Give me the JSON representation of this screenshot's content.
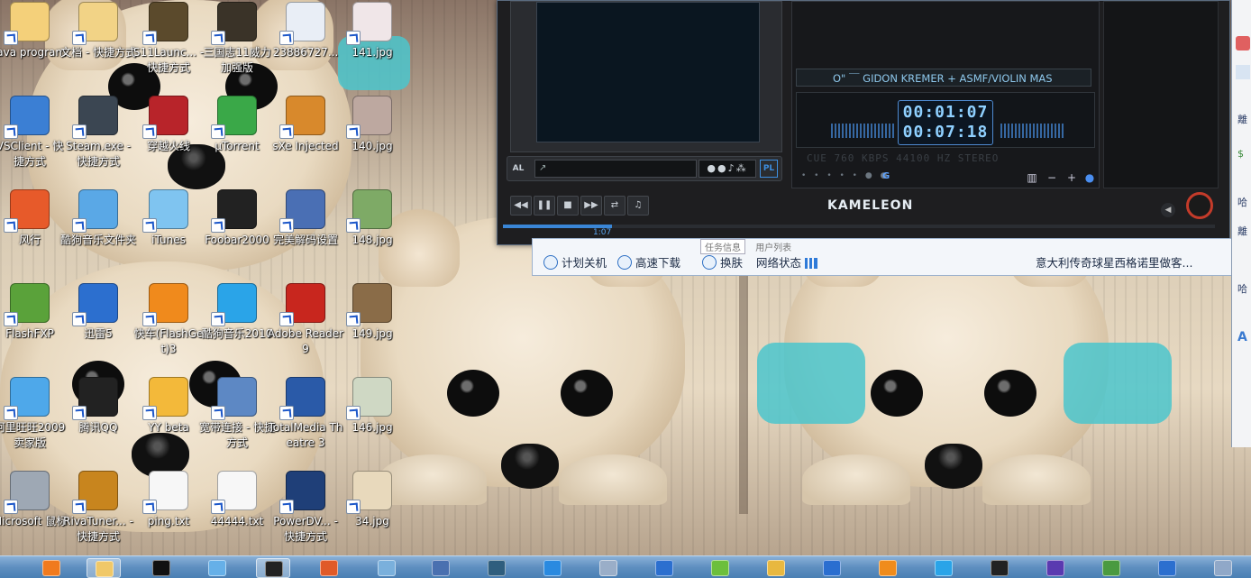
{
  "desktop": {
    "icons": [
      {
        "label": "java program",
        "col": 0,
        "row": 0,
        "color": "#f4d07a"
      },
      {
        "label": "文档 - 快捷方式",
        "col": 1,
        "row": 0,
        "color": "#f2d386"
      },
      {
        "label": "S11Launc... - 快捷方式",
        "col": 2,
        "row": 0,
        "color": "#5b4a2c"
      },
      {
        "label": "三国志11威力加强版",
        "col": 3,
        "row": 0,
        "color": "#3a3328"
      },
      {
        "label": "23886727...",
        "col": 4,
        "row": 0,
        "color": "#e9eef6"
      },
      {
        "label": "141.jpg",
        "col": 5,
        "row": 0,
        "color": "#f0e6e8"
      },
      {
        "label": "VSClient - 快捷方式",
        "col": 0,
        "row": 1,
        "color": "#3b7fd4"
      },
      {
        "label": "Steam.exe - 快捷方式",
        "col": 1,
        "row": 1,
        "color": "#3b4652"
      },
      {
        "label": "穿越火线",
        "col": 2,
        "row": 1,
        "color": "#b8242a"
      },
      {
        "label": "µTorrent",
        "col": 3,
        "row": 1,
        "color": "#3aa848"
      },
      {
        "label": "sXe Injected",
        "col": 4,
        "row": 1,
        "color": "#d8892c"
      },
      {
        "label": "140.jpg",
        "col": 5,
        "row": 1,
        "color": "#bda8a0"
      },
      {
        "label": "风行",
        "col": 0,
        "row": 2,
        "color": "#e75a2a"
      },
      {
        "label": "酷狗音乐文件夹",
        "col": 1,
        "row": 2,
        "color": "#5aa8e6"
      },
      {
        "label": "iTunes",
        "col": 2,
        "row": 2,
        "color": "#7fc4f0"
      },
      {
        "label": "Foobar2000",
        "col": 3,
        "row": 2,
        "color": "#222222"
      },
      {
        "label": "完美解码设置",
        "col": 4,
        "row": 2,
        "color": "#4a6fb4"
      },
      {
        "label": "148.jpg",
        "col": 5,
        "row": 2,
        "color": "#7eaa66"
      },
      {
        "label": "FlashFXP",
        "col": 0,
        "row": 3,
        "color": "#5aa23a"
      },
      {
        "label": "迅雷5",
        "col": 1,
        "row": 3,
        "color": "#2c6fcf"
      },
      {
        "label": "快车(FlashGet)3",
        "col": 2,
        "row": 3,
        "color": "#f08a1c"
      },
      {
        "label": "酷狗音乐2010",
        "col": 3,
        "row": 3,
        "color": "#2aa4e8"
      },
      {
        "label": "Adobe Reader 9",
        "col": 4,
        "row": 3,
        "color": "#c8261e"
      },
      {
        "label": "149.jpg",
        "col": 5,
        "row": 3,
        "color": "#8a6c48"
      },
      {
        "label": "阿里旺旺2009卖家版",
        "col": 0,
        "row": 4,
        "color": "#4ea8ea"
      },
      {
        "label": "腾讯QQ",
        "col": 1,
        "row": 4,
        "color": "#222222"
      },
      {
        "label": "YY beta",
        "col": 2,
        "row": 4,
        "color": "#f3b93a"
      },
      {
        "label": "宽带连接 - 快捷方式",
        "col": 3,
        "row": 4,
        "color": "#5d88c4"
      },
      {
        "label": "TotalMedia Theatre 3",
        "col": 4,
        "row": 4,
        "color": "#2a5aa8"
      },
      {
        "label": "146.jpg",
        "col": 5,
        "row": 4,
        "color": "#cfd8c4"
      },
      {
        "label": "Microsoft 鼠标",
        "col": 0,
        "row": 5,
        "color": "#9ea8b4"
      },
      {
        "label": "RivaTuner... - 快捷方式",
        "col": 1,
        "row": 5,
        "color": "#c8851e"
      },
      {
        "label": "ping.txt",
        "col": 2,
        "row": 5,
        "color": "#f7f7f7"
      },
      {
        "label": "44444.txt",
        "col": 3,
        "row": 5,
        "color": "#f7f7f7"
      },
      {
        "label": "PowerDV... - 快捷方式",
        "col": 4,
        "row": 5,
        "color": "#1f3f78"
      },
      {
        "label": "34.jpg",
        "col": 5,
        "row": 5,
        "color": "#e8d9bc"
      }
    ]
  },
  "player": {
    "marquee": "O\" ￣ GIDON KREMER + ASMF/VIOLIN MAS",
    "elapsed": "00:01:07",
    "total": "00:07:18",
    "info": "CUE  760 KBPS  44100 HZ  STEREO",
    "brand": "KAMELEON",
    "seek_time": "1:07",
    "seek_fraction": 0.153,
    "al_label": "AL",
    "pl_tag": "PL",
    "g_label": "G",
    "buttons": {
      "prev": "◀◀",
      "pause": "❚❚",
      "stop": "■",
      "next": "▶▶",
      "repeat": "⇄",
      "music": "♫",
      "minus": "−",
      "plus": "+"
    },
    "accent": "#3a86d6"
  },
  "statusbar": {
    "tabs": [
      "任务信息",
      "用户列表"
    ],
    "items": [
      {
        "label": "计划关机"
      },
      {
        "label": "高速下载"
      },
      {
        "label": "换肤"
      },
      {
        "label": "网络状态"
      }
    ],
    "news": "意大利传奇球星西格诺里做客..."
  },
  "edge": {
    "texts": [
      "離",
      "哈",
      "離",
      "哈"
    ]
  },
  "taskbar": {
    "items": [
      {
        "name": "media-player",
        "color": "#f07a1e",
        "active": false
      },
      {
        "name": "explorer",
        "color": "#f0c868",
        "active": true
      },
      {
        "name": "cmd",
        "color": "#111111",
        "active": false
      },
      {
        "name": "itunes",
        "color": "#66b0e8",
        "active": false
      },
      {
        "name": "foobar",
        "color": "#222222",
        "active": true
      },
      {
        "name": "office",
        "color": "#e05a28",
        "active": false
      },
      {
        "name": "notepad",
        "color": "#7ab0dc",
        "active": false
      },
      {
        "name": "network",
        "color": "#4a70b0",
        "active": false
      },
      {
        "name": "audition",
        "color": "#2f5e7e",
        "active": false
      },
      {
        "name": "ie",
        "color": "#2a8ae0",
        "active": false
      },
      {
        "name": "taskmgr",
        "color": "#9aaec8",
        "active": false
      },
      {
        "name": "xunlei",
        "color": "#2c6fcf",
        "active": false
      },
      {
        "name": "pps",
        "color": "#6cbf3c",
        "active": false
      },
      {
        "name": "game",
        "color": "#e8b840",
        "active": false
      },
      {
        "name": "feather",
        "color": "#2a6ed0",
        "active": false
      },
      {
        "name": "info",
        "color": "#f08c1c",
        "active": false
      },
      {
        "name": "kugou",
        "color": "#2aa4e8",
        "active": false
      },
      {
        "name": "qq",
        "color": "#222222",
        "active": false
      },
      {
        "name": "media",
        "color": "#5a3ab0",
        "active": false
      },
      {
        "name": "gpu",
        "color": "#4a9a40",
        "active": false
      },
      {
        "name": "xunlei2",
        "color": "#2c6fcf",
        "active": false
      },
      {
        "name": "tools",
        "color": "#90a8c8",
        "active": false
      }
    ]
  }
}
